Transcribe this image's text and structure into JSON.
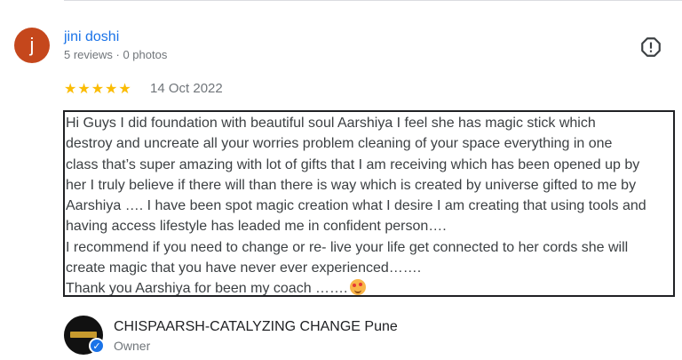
{
  "reviewer": {
    "avatar_letter": "j",
    "avatar_color": "#c5471c",
    "name": "jini doshi",
    "meta": "5 reviews · 0 photos"
  },
  "review": {
    "rating_stars": 5,
    "stars": [
      "★",
      "★",
      "★",
      "★",
      "★"
    ],
    "date": "14 Oct 2022",
    "lines": [
      "Hi Guys I did foundation with beautiful soul Aarshiya I feel she has magic stick which",
      "destroy and uncreate all your worries problem cleaning of your space everything in one",
      "class that’s super amazing with lot of gifts that I am receiving which has been opened up by",
      "her I truly believe if there will than there is way which is created by universe gifted to me by",
      "Aarshiya …. I have been spot magic creation what I desire I am creating that using tools and",
      "having access lifestyle has leaded me in confident person….",
      "I recommend if you need to change or re- live your life get connected to her cords she will",
      "create magic that you have never ever experienced…….",
      "Thank you Aarshiya for been my coach ……."
    ],
    "emoji": "smiling-face-with-hearts-icon"
  },
  "owner": {
    "name": "CHISPAARSH-CATALYZING CHANGE Pune",
    "role": "Owner"
  },
  "icons": {
    "report": "report-icon",
    "verified": "verified-check-icon"
  },
  "colors": {
    "link_blue": "#1a73e8",
    "star_yellow": "#fbbc04"
  }
}
